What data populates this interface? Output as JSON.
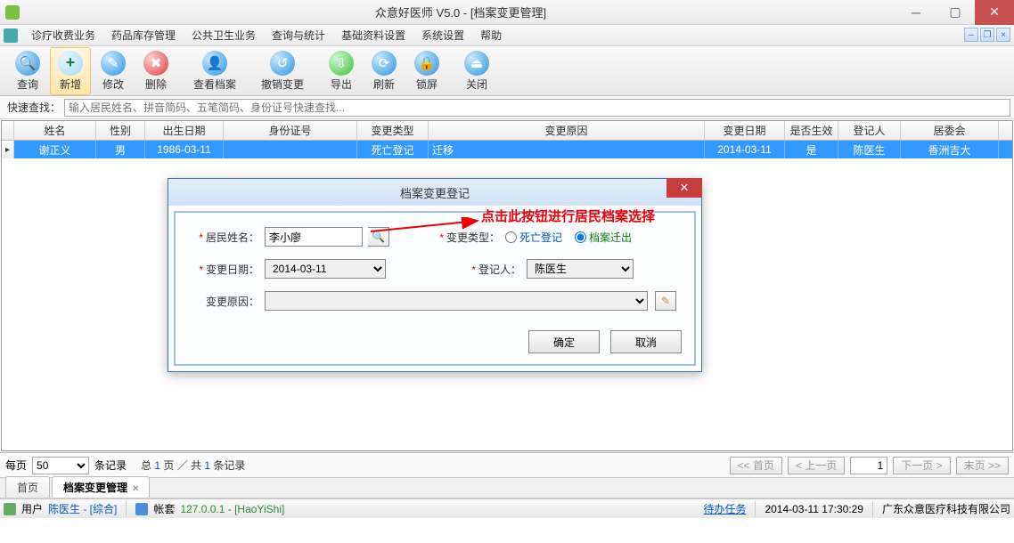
{
  "titlebar": {
    "title": "众意好医师 V5.0 - [档案变更管理]"
  },
  "menu": [
    "诊疗收费业务",
    "药品库存管理",
    "公共卫生业务",
    "查询与统计",
    "基础资料设置",
    "系统设置",
    "帮助"
  ],
  "toolbar": [
    {
      "label": "查询",
      "icon": "search"
    },
    {
      "label": "新增",
      "icon": "plus",
      "active": true
    },
    {
      "label": "修改",
      "icon": "edit"
    },
    {
      "label": "删除",
      "icon": "delete"
    },
    {
      "label": "查看档案",
      "icon": "profile",
      "sep": true
    },
    {
      "label": "撤销变更",
      "icon": "undo",
      "sep": true
    },
    {
      "label": "导出",
      "icon": "export"
    },
    {
      "label": "刷新",
      "icon": "refresh"
    },
    {
      "label": "锁屏",
      "icon": "lock"
    },
    {
      "label": "关闭",
      "icon": "close",
      "sep": true
    }
  ],
  "quicksearch": {
    "label": "快速查找：",
    "placeholder": "输入居民姓名、拼音简码、五笔简码、身份证号快速查找..."
  },
  "grid": {
    "headers": [
      "姓名",
      "性别",
      "出生日期",
      "身份证号",
      "变更类型",
      "变更原因",
      "变更日期",
      "是否生效",
      "登记人",
      "居委会"
    ],
    "row": {
      "name": "谢正义",
      "sex": "男",
      "birth": "1986-03-11",
      "id": "",
      "chtype": "死亡登记",
      "reason": "迁移",
      "chdate": "2014-03-11",
      "effect": "是",
      "reg": "陈医生",
      "comm": "香洲吉大"
    }
  },
  "pager": {
    "per_label": "每页",
    "per_value": "50",
    "per_unit": "条记录",
    "stats_prefix": "总 ",
    "pages": "1",
    "stats_mid": " 页 ／ 共 ",
    "records": "1",
    "stats_suffix": " 条记录",
    "first": "<< 首页",
    "prev": "< 上一页",
    "page": "1",
    "next": "下一页 >",
    "last": "末页 >>"
  },
  "tabs": [
    {
      "label": "首页"
    },
    {
      "label": "档案变更管理",
      "active": true
    }
  ],
  "status": {
    "user_lbl": "用户",
    "user": "陈医生 - [综合]",
    "acct_lbl": "帐套",
    "acct": "127.0.0.1 - [HaoYiShi]",
    "tasks": "待办任务",
    "datetime": "2014-03-11 17:30:29",
    "company": "广东众意医疗科技有限公司"
  },
  "dialog": {
    "title": "档案变更登记",
    "name_lbl": "居民姓名：",
    "name_val": "李小廖",
    "type_lbl": "变更类型：",
    "type_opt1": "死亡登记",
    "type_opt2": "档案迁出",
    "date_lbl": "变更日期：",
    "date_val": "2014-03-11",
    "reg_lbl": "登记人：",
    "reg_val": "陈医生",
    "reason_lbl": "变更原因：",
    "ok": "确定",
    "cancel": "取消"
  },
  "annotation": "点击此按钮进行居民档案选择"
}
